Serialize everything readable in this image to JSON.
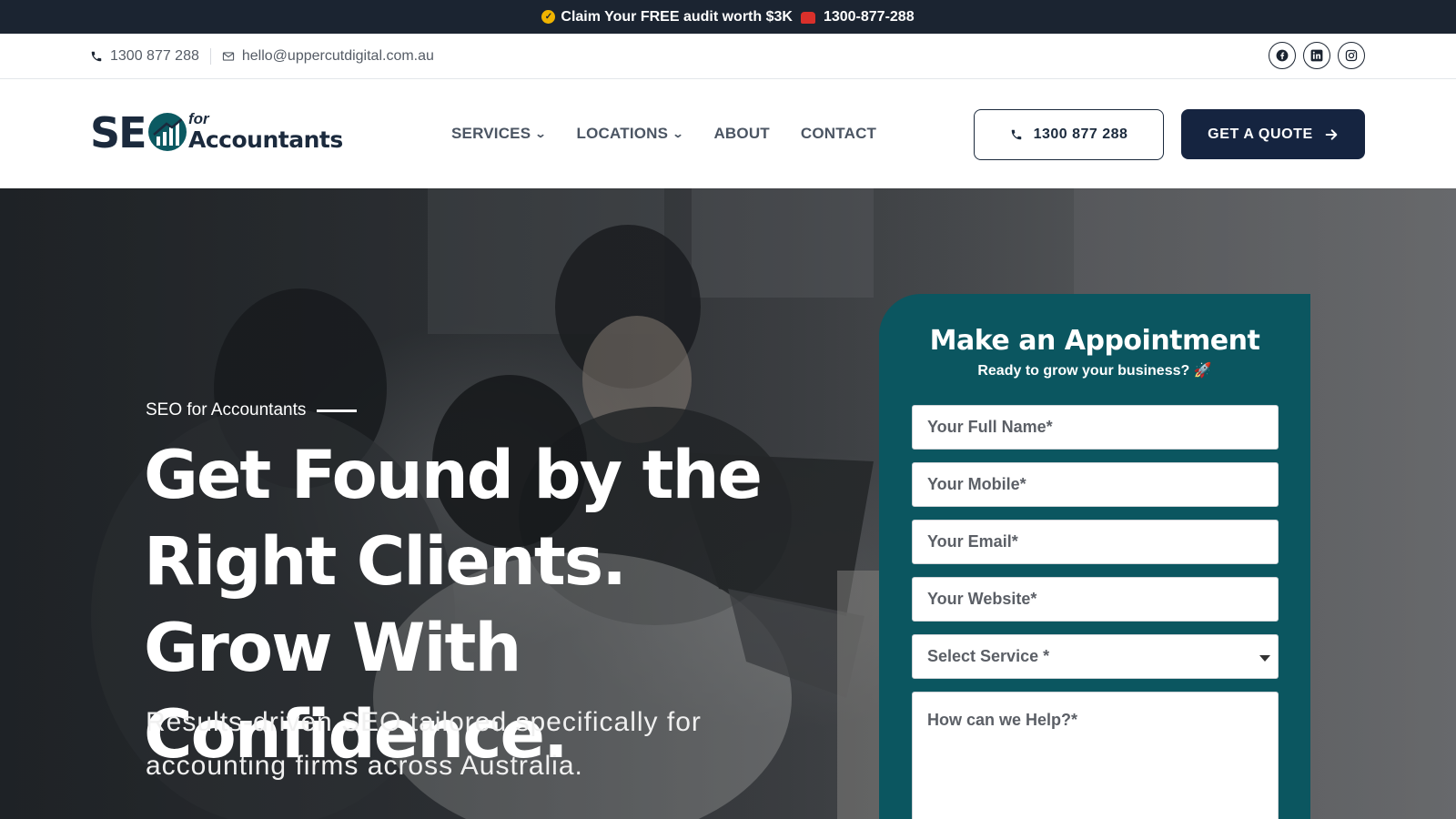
{
  "announcement": {
    "text": "Claim Your FREE audit worth $3K",
    "phone": "1300-877-288"
  },
  "contact_bar": {
    "phone": "1300 877 288",
    "email": "hello@uppercutdigital.com.au",
    "social": [
      "facebook-icon",
      "linkedin-icon",
      "instagram-icon"
    ]
  },
  "logo": {
    "seo": "SE",
    "for": "for",
    "accountants": "Accountants"
  },
  "nav": {
    "items": [
      {
        "label": "SERVICES",
        "dropdown": true
      },
      {
        "label": "LOCATIONS",
        "dropdown": true
      },
      {
        "label": "ABOUT",
        "dropdown": false
      },
      {
        "label": "CONTACT",
        "dropdown": false
      }
    ],
    "phone_button": "1300 877 288",
    "quote_button": "GET A QUOTE"
  },
  "hero": {
    "eyebrow": "SEO for Accountants",
    "headline": "Get Found by the Right Clients. Grow With Confidence.",
    "subtext": "Results-driven SEO tailored specifically for accounting firms across Australia."
  },
  "form": {
    "title": "Make an Appointment",
    "subtitle": "Ready to grow your business? 🚀",
    "fields": {
      "name": "Your Full Name*",
      "mobile": "Your Mobile*",
      "email": "Your Email*",
      "website": "Your Website*",
      "service": "Select Service *",
      "help": "How can we Help?*"
    }
  },
  "colors": {
    "dark": "#1b2431",
    "navy": "#152440",
    "teal": "#0b5660"
  }
}
